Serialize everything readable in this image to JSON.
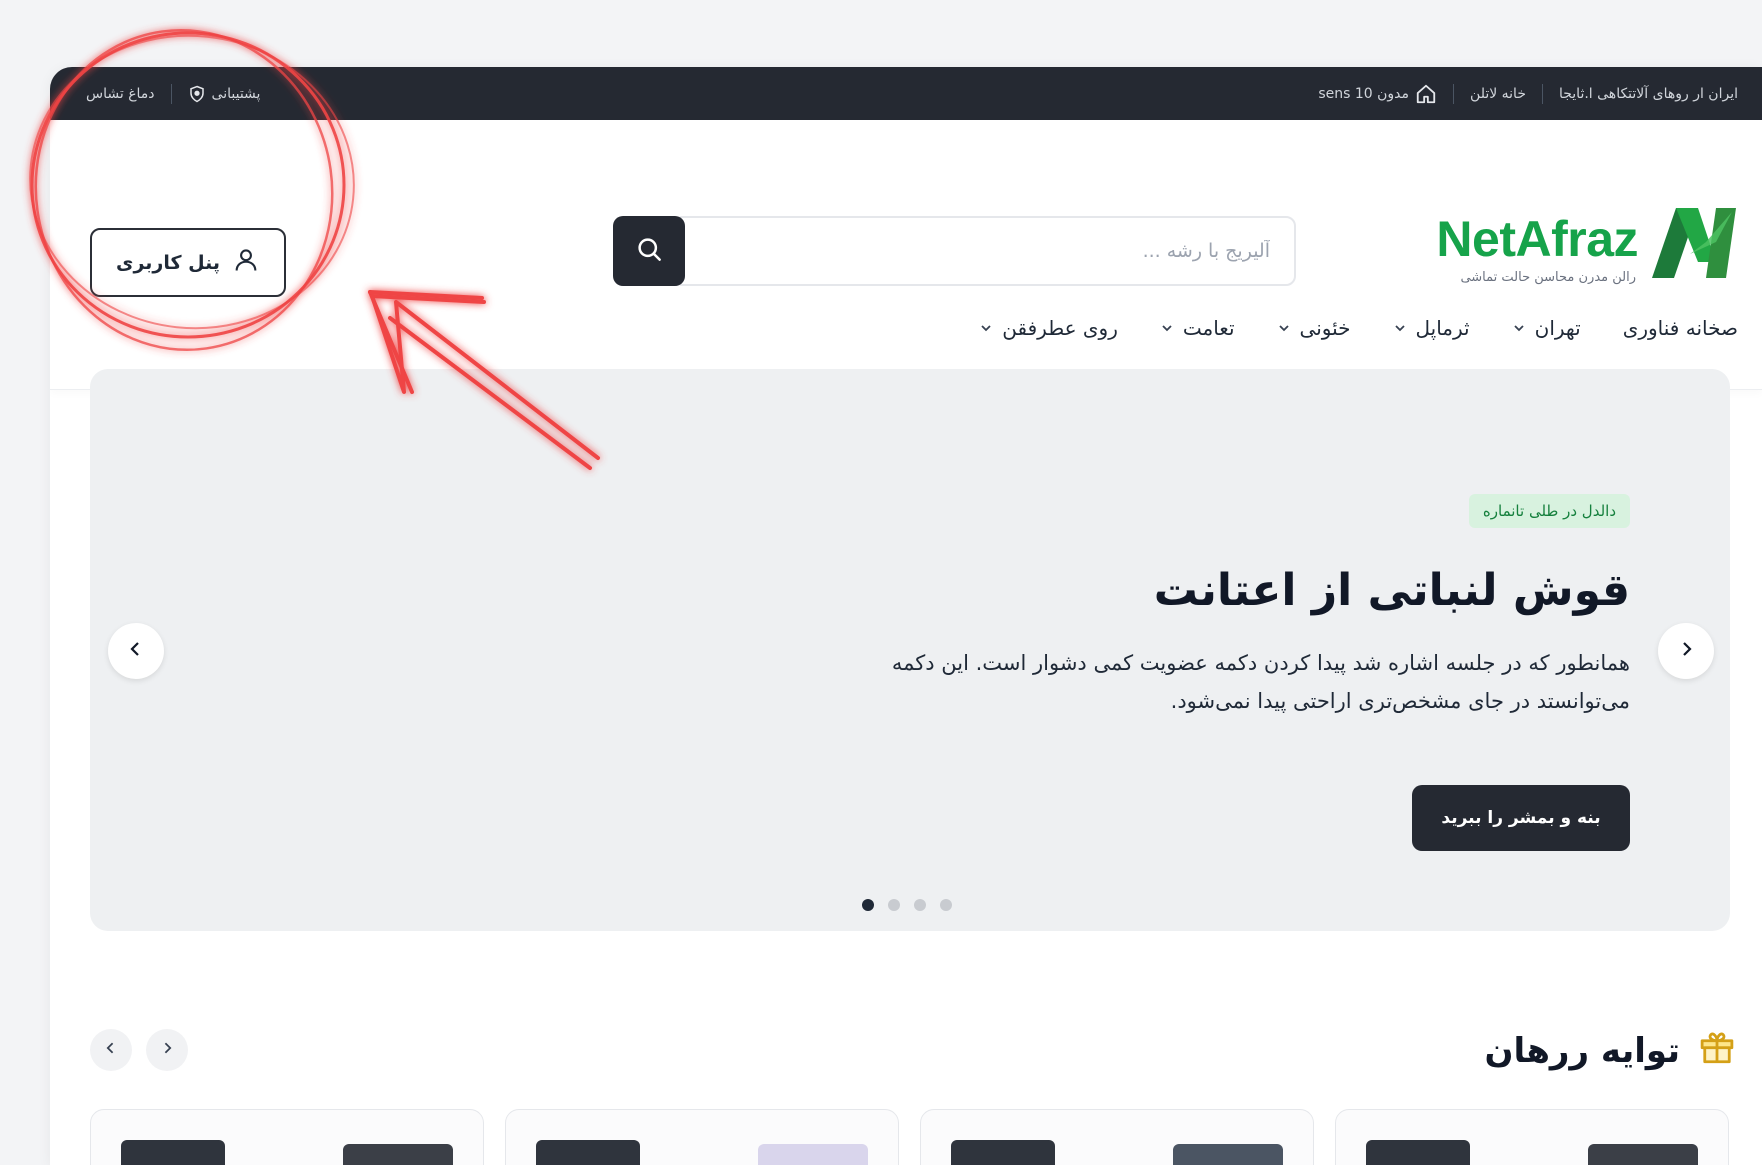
{
  "topbar": {
    "right_items": [
      {
        "icon": "home-icon",
        "label": "مدون 10 sens"
      },
      {
        "label": "خانه لاتلن"
      },
      {
        "label": "ایران ار روهای آلاتتکاهی ا.ثایجا"
      }
    ],
    "left_items": [
      {
        "label": "دماغ تشاس"
      },
      {
        "icon": "shield-icon",
        "label": "پشتیبانی"
      }
    ]
  },
  "header": {
    "user_panel_label": "پنل کاربری",
    "search_placeholder": "آلیریج با رشه ...",
    "logo": {
      "brand": "NetAfraz",
      "tagline": "رالن مدرن محاسن حالت تماشی"
    },
    "nav": [
      {
        "label": "صخانه فناوری",
        "has_dropdown": false
      },
      {
        "label": "تهران",
        "has_dropdown": true
      },
      {
        "label": "ثرماپل",
        "has_dropdown": true
      },
      {
        "label": "خئونی",
        "has_dropdown": true
      },
      {
        "label": "تعامت",
        "has_dropdown": true
      },
      {
        "label": "روی عطرفقن",
        "has_dropdown": true
      }
    ]
  },
  "hero": {
    "badge": "دالدل در طلی تانماره",
    "title": "قوش لنباتی از اعتانت",
    "description": "همانطور که در جلسه اشاره شد پیدا کردن دکمه عضویت کمی دشوار است. این دکمه می‌توانستد در جای مشخص‌تری اراحتی پیدا نمی‌شود.",
    "cta_label": "بنه و بمشر را ببرید",
    "slides": 4,
    "active_slide": 1
  },
  "offers": {
    "title": "توایه ررهان",
    "icon": "gift-icon",
    "cards": 4
  },
  "colors": {
    "dark": "#252932",
    "brand_green": "#16a34a",
    "annotation_red": "#ef4444"
  }
}
